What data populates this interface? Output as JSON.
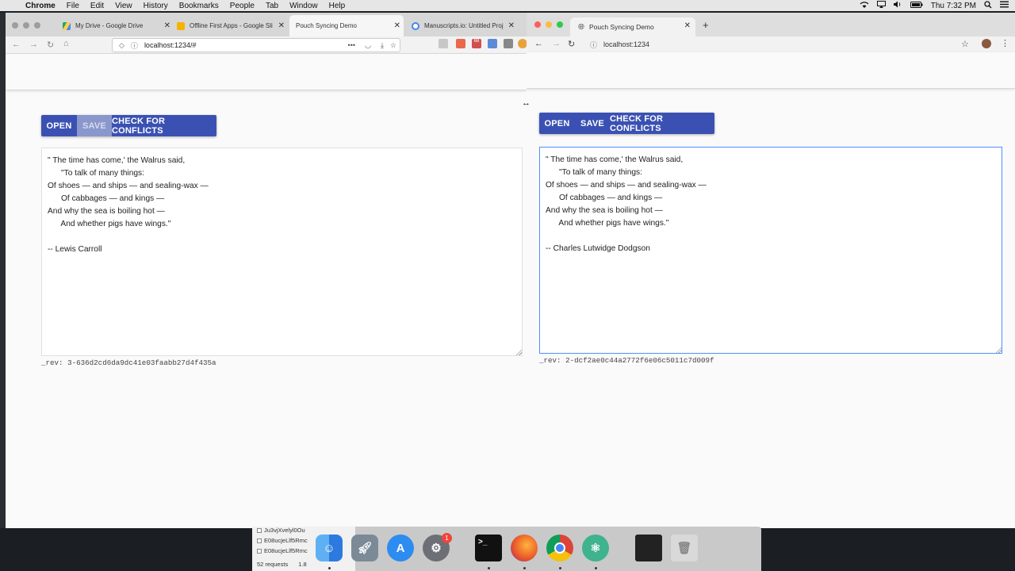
{
  "menubar": {
    "app_name": "Chrome",
    "items": [
      "File",
      "Edit",
      "View",
      "History",
      "Bookmarks",
      "People",
      "Tab",
      "Window",
      "Help"
    ],
    "clock": "Thu 7:32 PM"
  },
  "left_window": {
    "tabs": [
      {
        "title": "My Drive - Google Drive",
        "color": "#1fa463"
      },
      {
        "title": "Offline First Apps - Google Sli",
        "color": "#f4b400"
      },
      {
        "title": "Pouch Syncing Demo",
        "color": "#ffffff",
        "active": true
      },
      {
        "title": "Manuscripts.io: Untitled Proje",
        "color": "#4285f4"
      }
    ],
    "url": "localhost:1234/#",
    "buttons": {
      "open": "OPEN",
      "save": "SAVE",
      "check": "CHECK FOR CONFLICTS"
    },
    "text": "\" The time has come,' the Walrus said,\n      \"To talk of many things:\nOf shoes — and ships — and sealing-wax —\n      Of cabbages — and kings —\nAnd why the sea is boiling hot —\n      And whether pigs have wings.\"\n\n-- Lewis Carroll",
    "rev": "_rev: 3-636d2cd6da9dc41e03faabb27d4f435a",
    "ext_badge": "68"
  },
  "right_window": {
    "tab_title": "Pouch Syncing Demo",
    "url": "localhost:1234",
    "buttons": {
      "open": "OPEN",
      "save": "SAVE",
      "check": "CHECK FOR CONFLICTS"
    },
    "text": "\" The time has come,' the Walrus said,\n      \"To talk of many things:\nOf shoes — and ships — and sealing-wax —\n      Of cabbages — and kings —\nAnd why the sea is boiling hot —\n      And whether pigs have wings.\"\n\n-- Charles Lutwidge Dodgson",
    "rev": "_rev: 2-dcf2ae0c44a2772f6e06c5011c7d009f"
  },
  "devtools_partial": {
    "rows": [
      "Ju3vjXvelyl0Ou",
      "E08ucjeLlf5Rmc",
      "E08ucjeLlf5Rmc"
    ],
    "requests": "52 requests",
    "size": "1.8"
  },
  "dock": {
    "system_prefs_badge": "1"
  },
  "colors": {
    "primary": "#3a51b3",
    "primary_disabled": "#8a97cc",
    "focus": "#4d90fe"
  }
}
